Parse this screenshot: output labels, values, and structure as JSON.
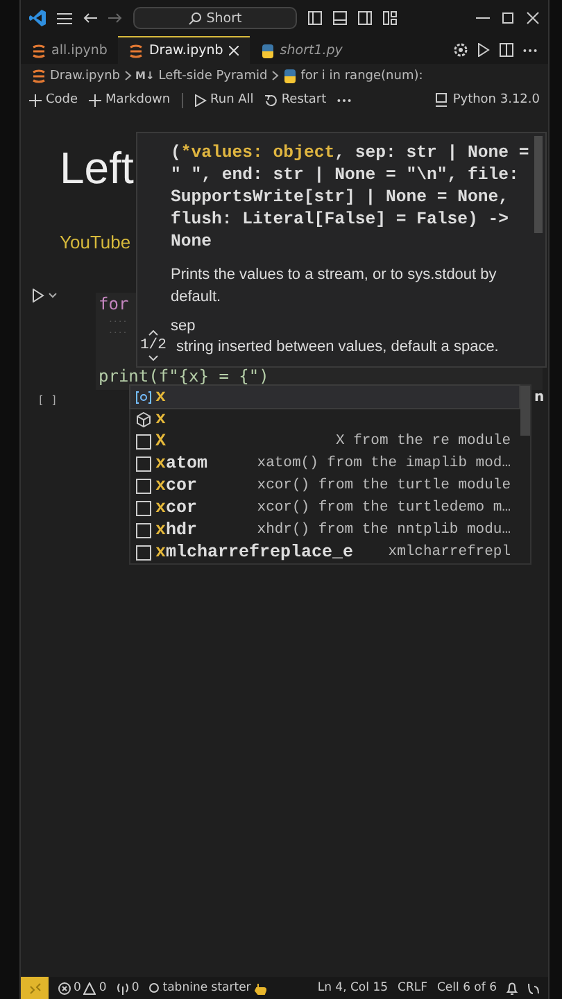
{
  "title_bar": {
    "search": "Short"
  },
  "tabs": [
    {
      "label": "all.ipynb",
      "kind": "notebook",
      "selected": false
    },
    {
      "label": "Draw.ipynb",
      "kind": "notebook",
      "selected": true
    },
    {
      "label": "short1.py",
      "kind": "python",
      "selected": false
    }
  ],
  "breadcrumb": [
    {
      "label": "Draw.ipynb",
      "kind": "notebook"
    },
    {
      "label": "Left-side Pyramid",
      "kind": "markdown",
      "icon_text": "M↓"
    },
    {
      "label": "for i in range(num):",
      "kind": "python"
    }
  ],
  "toolbar": {
    "actions": [
      {
        "label": "Code",
        "kind": "add"
      },
      {
        "label": "Markdown",
        "kind": "add"
      },
      {
        "label": "Run All",
        "kind": "run"
      },
      {
        "label": "Restart",
        "kind": "restart"
      }
    ],
    "kernel": "Python 3.12.0"
  },
  "notebook": {
    "heading": "Left",
    "subtitle": "YouTube",
    "keyword": "for",
    "last_line": "print(f\"{x} = {\")",
    "output_marker": "[ ]",
    "trailing_text": "n"
  },
  "hover": {
    "open": "(",
    "active_param": "*values: object",
    "rest": ", sep: str | None = \" \", end: str | None = \"\\n\", file: SupportsWrite[str] | None = None, flush: Literal[False] = False) -> None",
    "description": "Prints the values to a stream, or to sys.stdout by default.",
    "param_name": "sep",
    "param_doc": "string inserted between values, default a space.",
    "overload": "1/2"
  },
  "suggestions": [
    {
      "kind": "variable",
      "label": "**x**",
      "selected": true
    },
    {
      "kind": "module",
      "label": "**x**",
      "selected": false
    },
    {
      "kind": "reference",
      "label": "**X**",
      "detail": "X from the re module",
      "selected": false
    },
    {
      "kind": "reference",
      "label": "**x**atom",
      "detail": "xatom() from the imaplib mod…",
      "selected": false
    },
    {
      "kind": "reference",
      "label": "**x**cor",
      "detail": "xcor() from the turtle module",
      "selected": false
    },
    {
      "kind": "reference",
      "label": "**x**cor",
      "detail": "xcor() from the turtledemo m…",
      "selected": false
    },
    {
      "kind": "reference",
      "label": "**x**hdr",
      "detail": "xhdr() from the nntplib modu…",
      "selected": false
    },
    {
      "kind": "reference",
      "label": "**x**mlcharrefreplace_e",
      "detail": "xmlcharrefrepl",
      "selected": false
    }
  ],
  "status_bar": {
    "errors": "0",
    "warnings": "0",
    "ports": "0",
    "extension": "tabnine starter",
    "position": "Ln 4, Col 15",
    "eol": "CRLF",
    "cell": "Cell 6 of 6"
  }
}
